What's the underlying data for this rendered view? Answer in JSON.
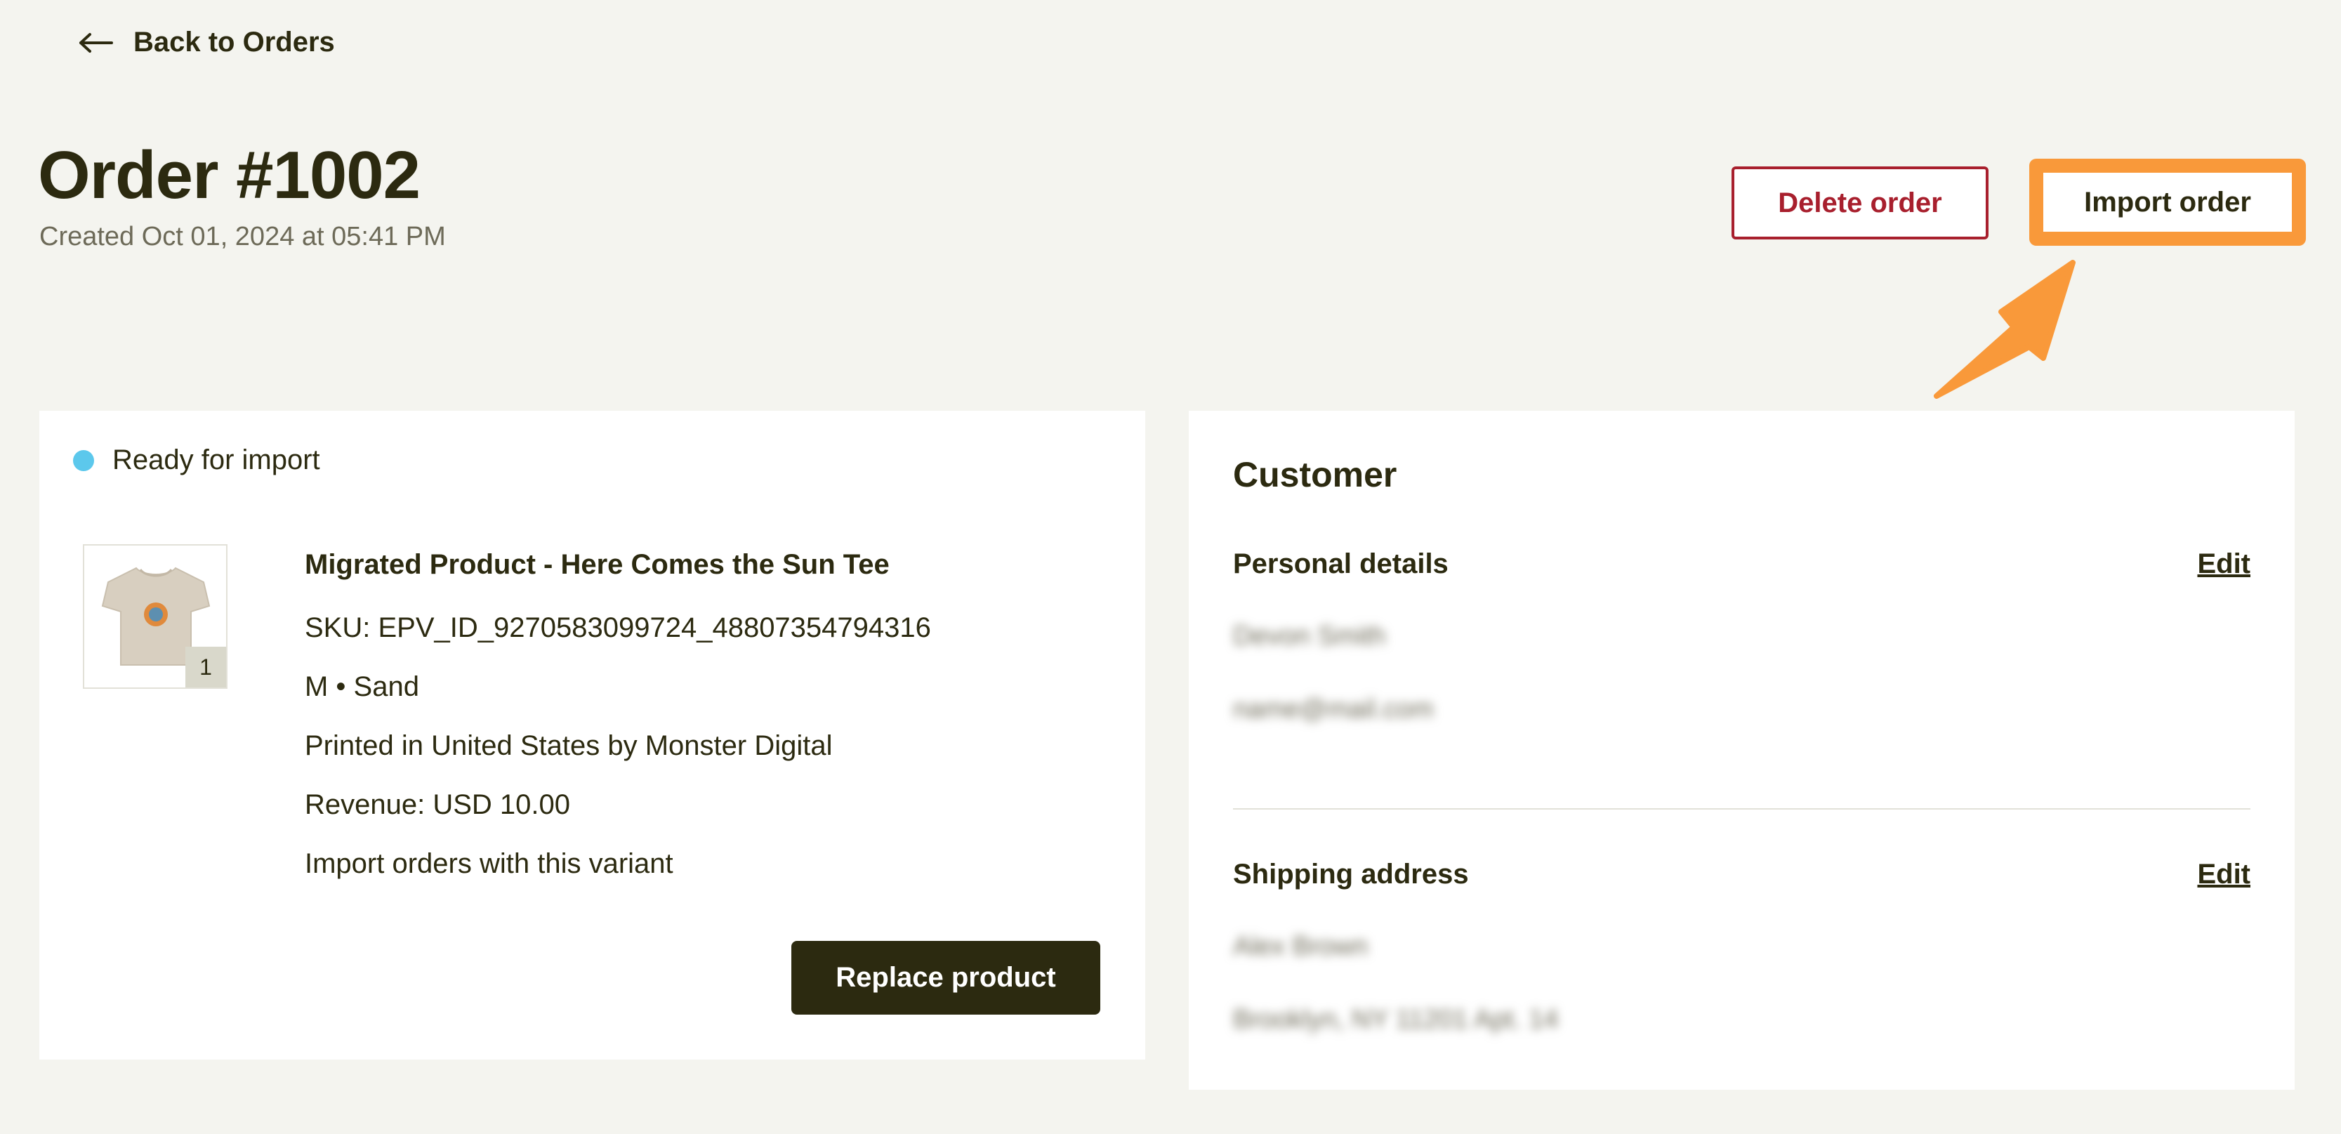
{
  "nav": {
    "back_label": "Back to Orders"
  },
  "header": {
    "title": "Order #1002",
    "created": "Created Oct 01, 2024 at 05:41 PM",
    "delete_label": "Delete order",
    "import_label": "Import order"
  },
  "order": {
    "status": "Ready for import",
    "quantity": "1",
    "product_name": "Migrated Product - Here Comes the Sun Tee",
    "sku": "SKU: EPV_ID_9270583099724_48807354794316",
    "variant": "M • Sand",
    "printed": "Printed in United States by Monster Digital",
    "revenue": "Revenue: USD 10.00",
    "import_note": "Import orders with this variant",
    "replace_label": "Replace product"
  },
  "customer": {
    "title": "Customer",
    "personal_label": "Personal details",
    "personal_edit": "Edit",
    "name_blurred": "Devon Smith",
    "email_blurred": "name@mail.com",
    "shipping_label": "Shipping address",
    "shipping_edit": "Edit",
    "address_name_blurred": "Alex Brown",
    "address_line_blurred": "Brooklyn, NY 11201 Apt. 14"
  },
  "colors": {
    "accent_dark": "#2c2a10",
    "danger": "#a81f2d",
    "highlight": "#f9993a",
    "status_ready": "#5cc8ec",
    "background": "#f4f4ef"
  }
}
